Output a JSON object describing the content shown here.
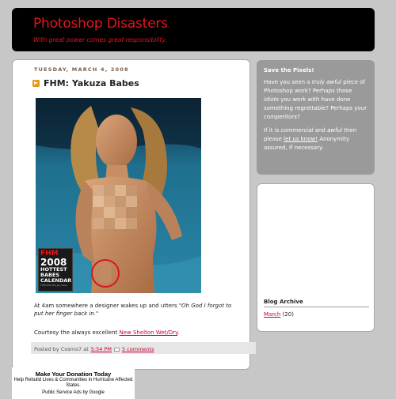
{
  "header": {
    "title": "Photoshop Disasters",
    "tagline": "With great power comes great responsibility."
  },
  "post": {
    "date": "TUESDAY, MARCH 4, 2008",
    "title": "FHM: Yakuza Babes",
    "cover": {
      "brand": "FHM",
      "year": "2008",
      "line1": "HOTTEST",
      "line2": "BABES",
      "line3": "CALENDAR",
      "small": "FHM with the Jan issue"
    },
    "body_prefix": "At 4am somewhere a designer wakes up and utters ",
    "body_quote": "\"Oh God I forgot to put her finger back in.\"",
    "courtesy_prefix": "Courtesy the always excellent ",
    "courtesy_link": "New Shelton Wet/Dry",
    "courtesy_suffix": ".",
    "posted_by": "Posted by Cosmo7 at",
    "time": "5:54 PM",
    "comments": "5 comments"
  },
  "ad": {
    "title": "Make Your Donation Today",
    "body": "Help Rebuild Lives & Communities in Hurricane Affected States.",
    "by": "Public Service Ads by Google"
  },
  "sidebar": {
    "save": {
      "heading": "Save the Pixels!",
      "t1": "Have you seen a ",
      "t1_em": "truly awful",
      "t2": " piece of Photoshop work? Perhaps those ",
      "t2_em": "idiots",
      "t3": " you work with have done something regrettable? Perhaps your ",
      "t3_em": "competitors",
      "t4": "?",
      "p2_a": "If it is ",
      "p2_em1": "commercial",
      "p2_b": " and ",
      "p2_em2": "awful",
      "p2_c": " then please ",
      "p2_link": "let us know!",
      "p2_d": " Anonymity assured, if necessary."
    },
    "archive": {
      "heading": "Blog Archive",
      "month": "March",
      "count": " (20)"
    }
  },
  "colors": {
    "title_red": "#e2151d",
    "link_red": "#cc0033",
    "sidebar_grey": "#9a9a9a",
    "bg": "#c7c7c7"
  }
}
